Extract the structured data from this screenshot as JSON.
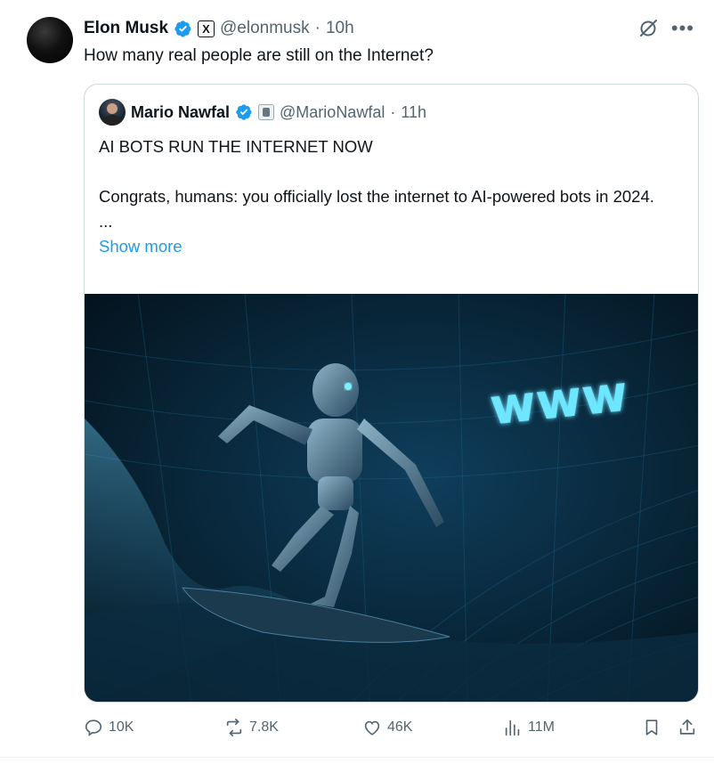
{
  "tweet": {
    "author_name": "Elon Musk",
    "handle": "@elonmusk",
    "separator": "·",
    "time": "10h",
    "x_badge": "X",
    "text": "How many real people are still on the Internet?"
  },
  "quote": {
    "author_name": "Mario Nawfal",
    "handle": "@MarioNawfal",
    "separator": "·",
    "time": "11h",
    "line1": "AI BOTS RUN THE INTERNET NOW",
    "line2": "Congrats, humans: you officially lost the internet to AI-powered bots in 2024.",
    "ellipsis": "...",
    "show_more": "Show more",
    "image_text": "www"
  },
  "actions": {
    "replies": "10K",
    "reposts": "7.8K",
    "likes": "46K",
    "views": "11M"
  },
  "icons": {
    "verified": "verified-badge-icon",
    "grok": "grok-icon",
    "more": "more-icon",
    "reply": "reply-icon",
    "repost": "repost-icon",
    "like": "heart-icon",
    "views": "views-icon",
    "bookmark": "bookmark-icon",
    "share": "share-icon"
  },
  "colors": {
    "accent": "#1d9bf0",
    "muted": "#536471",
    "text": "#0f1419",
    "border": "#cfd9de"
  }
}
